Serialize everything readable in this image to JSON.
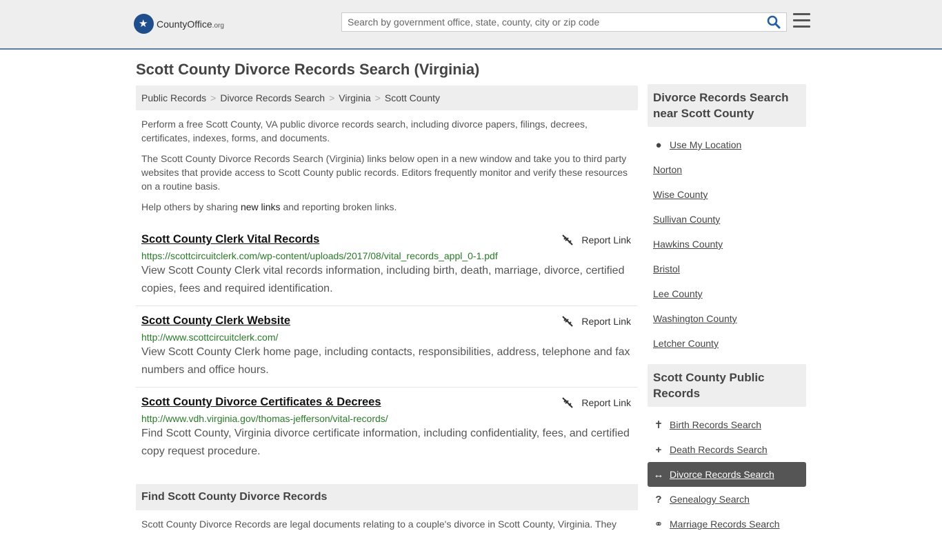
{
  "header": {
    "logo_name": "CountyOffice",
    "logo_suffix": ".org",
    "search_placeholder": "Search by government office, state, county, city or zip code"
  },
  "page_title": "Scott County Divorce Records Search (Virginia)",
  "breadcrumb": [
    "Public Records",
    "Divorce Records Search",
    "Virginia",
    "Scott County"
  ],
  "intro": {
    "p1": "Perform a free Scott County, VA public divorce records search, including divorce papers, filings, decrees, certificates, indexes, forms, and documents.",
    "p2": "The Scott County Divorce Records Search (Virginia) links below open in a new window and take you to third party websites that provide access to Scott County public records. Editors frequently monitor and verify these resources on a routine basis.",
    "p3_pre": "Help others by sharing ",
    "p3_link": "new links",
    "p3_post": " and reporting broken links."
  },
  "report_label": "Report Link",
  "results": [
    {
      "title": "Scott County Clerk Vital Records",
      "url": "https://scottcircuitclerk.com/wp-content/uploads/2017/08/vital_records_appl_0-1.pdf",
      "description": "View Scott County Clerk vital records information, including birth, death, marriage, divorce, certified copies, fees and required identification."
    },
    {
      "title": "Scott County Clerk Website",
      "url": "http://www.scottcircuitclerk.com/",
      "description": "View Scott County Clerk home page, including contacts, responsibilities, address, telephone and fax numbers and office hours."
    },
    {
      "title": "Scott County Divorce Certificates & Decrees",
      "url": "http://www.vdh.virginia.gov/thomas-jefferson/vital-records/",
      "description": "Find Scott County, Virginia divorce certificate information, including confidentiality, fees, and certified copy request procedure."
    }
  ],
  "find_section": {
    "heading": "Find Scott County Divorce Records",
    "text": "Scott County Divorce Records are legal documents relating to a couple's divorce in Scott County, Virginia. They"
  },
  "sidebar": {
    "nearby_heading": "Divorce Records Search near Scott County",
    "use_location": "Use My Location",
    "nearby": [
      "Norton",
      "Wise County",
      "Sullivan County",
      "Hawkins County",
      "Bristol",
      "Lee County",
      "Washington County",
      "Letcher County"
    ],
    "public_heading": "Scott County Public Records",
    "public_records": [
      {
        "label": "Birth Records Search",
        "icon": "baby-icon"
      },
      {
        "label": "Death Records Search",
        "icon": "cross-icon"
      },
      {
        "label": "Divorce Records Search",
        "icon": "arrows-icon"
      },
      {
        "label": "Genealogy Search",
        "icon": "question-icon"
      },
      {
        "label": "Marriage Records Search",
        "icon": "rings-icon"
      }
    ],
    "active_index": 2
  }
}
